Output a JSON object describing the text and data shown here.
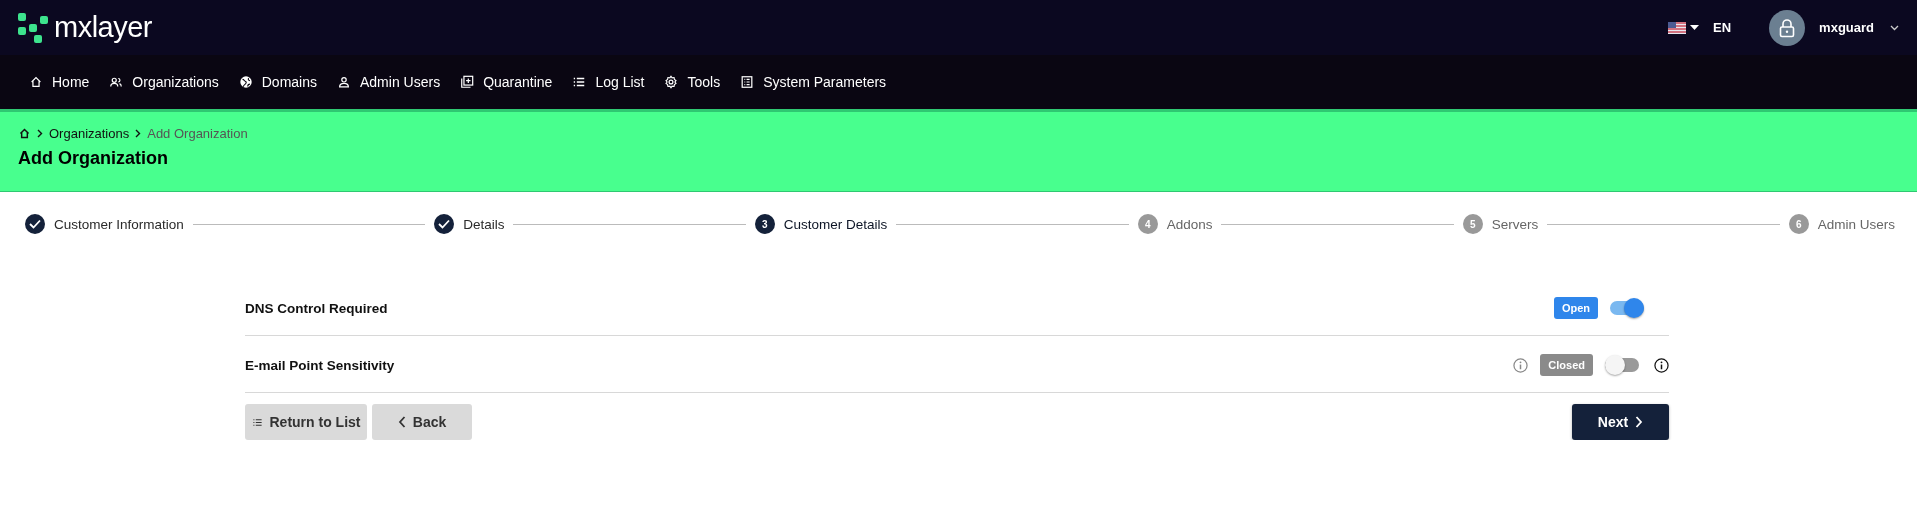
{
  "header": {
    "logo": "mxlayer",
    "language": "EN",
    "user": "mxguard"
  },
  "nav": [
    {
      "label": "Home"
    },
    {
      "label": "Organizations"
    },
    {
      "label": "Domains"
    },
    {
      "label": "Admin Users"
    },
    {
      "label": "Quarantine"
    },
    {
      "label": "Log List"
    },
    {
      "label": "Tools"
    },
    {
      "label": "System Parameters"
    }
  ],
  "breadcrumb": [
    "Organizations",
    "Add Organization"
  ],
  "page_title": "Add Organization",
  "steps": [
    {
      "label": "Customer Information",
      "completed": true,
      "selected": false
    },
    {
      "label": "Details",
      "completed": true,
      "selected": false
    },
    {
      "number": "3",
      "label": "Customer Details",
      "completed": false,
      "selected": true
    },
    {
      "number": "4",
      "label": "Addons",
      "completed": false,
      "selected": false
    },
    {
      "number": "5",
      "label": "Servers",
      "completed": false,
      "selected": false
    },
    {
      "number": "6",
      "label": "Admin Users",
      "completed": false,
      "selected": false
    }
  ],
  "settings": [
    {
      "label": "DNS Control Required",
      "badge": "Open",
      "on": true,
      "info": false
    },
    {
      "label": "E-mail Point Sensitivity",
      "badge": "Closed",
      "on": false,
      "info": true
    }
  ],
  "buttons": {
    "return": "Return to List",
    "back": "Back",
    "next": "Next"
  }
}
